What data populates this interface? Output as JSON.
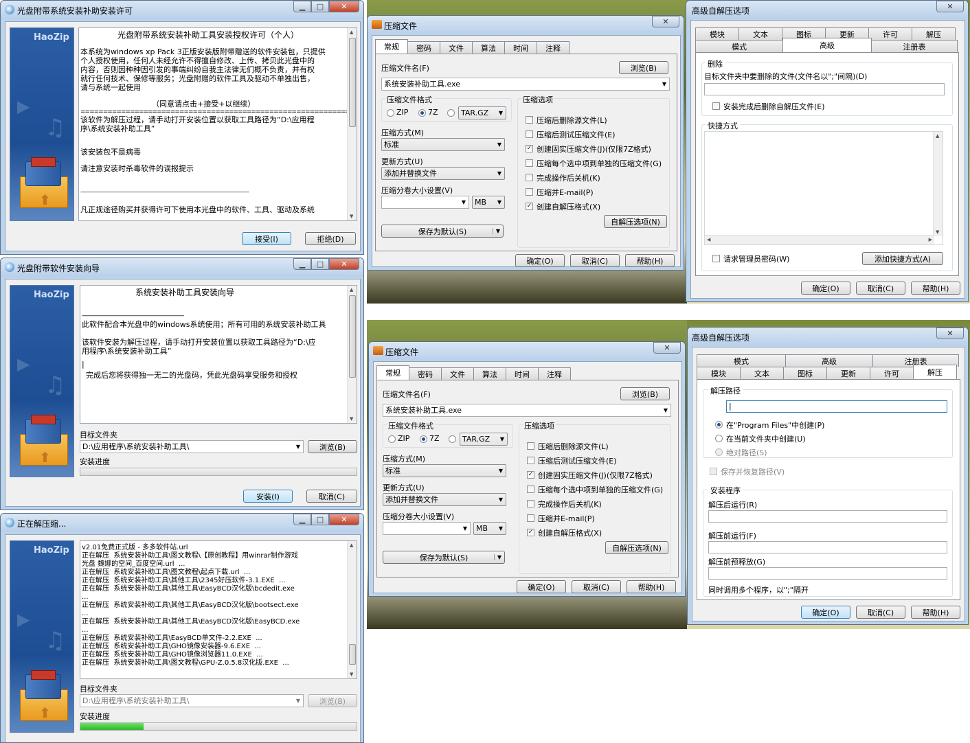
{
  "license_window": {
    "title": "光盘附带系统安装补助安装许可",
    "brand": "HaoZip",
    "heading": "光盘附带系统安装补助工具安装授权许可（个人）",
    "paragraph_lines": [
      "本系统为windows xp Pack 3正版安装版附带赠送的软件安装包，只提供",
      "个人授权使用，任何人未经允许不得擅自修改、上传、拷贝此光盘中的",
      "内容，否则因种种因引发的事端纠纷自我主法律无们概不负责，并有权",
      "就行任何技术、保修等服务；光盘附赠的软件工具及驱动不单独出售，",
      "请与系统一起使用"
    ],
    "agree_hint": "（同意请点击+接受+以继续）",
    "separator": "==============================================================",
    "path_note_lines": [
      "该软件为解压过程，请手动打开安装位置以获取工具路径为“D:\\应用程",
      "序\\系统安装补助工具”"
    ],
    "virus_note": "该安装包不是病毒",
    "antivirus_note": "请注意安装时杀毒软件的误报提示",
    "dash_line": "———————————————————————————————————",
    "purchase_note": "凡正规途径购买并获得许可下使用本光盘中的软件、工具、驱动及系统",
    "accept_button": "接受(I)",
    "reject_button": "拒绝(D)"
  },
  "wizard_window": {
    "title": "光盘附带软件安装向导",
    "brand": "HaoZip",
    "heading": "系统安装补助工具安装向导",
    "separator": "------------------------------------------------------------------",
    "line1": "此软件配合本光盘中的windows系统使用；所有可用的系统安装补助工具",
    "path_lines": [
      "该软件安装为解压过程，请手动打开安装位置以获取工具路径为“D:\\应",
      "用程序\\系统安装补助工具”"
    ],
    "cursor": "|",
    "complete_line": "完成后您将获得独一无二的光盘码，凭此光盘码享受服务和授权",
    "target_label": "目标文件夹",
    "target_value": "D:\\应用程序\\系统安装补助工具\\",
    "browse_button": "浏览(B)",
    "progress_label": "安装进度",
    "progress_value": 0,
    "install_button": "安装(I)",
    "cancel_button": "取消(C)"
  },
  "extract_window": {
    "title": "正在解压缩...",
    "brand": "HaoZip",
    "log_lines": [
      "v2.01免费正式版 - 多多软件站.url",
      "正在解压  系统安装补助工具\\图文教程\\【原创教程】用winrar制作游戏",
      "光盘 魏娜的空间_百度空间.url  ...",
      "正在解压  系统安装补助工具\\图文教程\\起点下载.url  ...",
      "正在解压  系统安装补助工具\\其他工具\\2345好压软件-3.1.EXE  ...",
      "正在解压  系统安装补助工具\\其他工具\\EasyBCD汉化版\\bcdedit.exe",
      "...",
      "正在解压  系统安装补助工具\\其他工具\\EasyBCD汉化版\\bootsect.exe",
      "...",
      "正在解压  系统安装补助工具\\其他工具\\EasyBCD汉化版\\EasyBCD.exe",
      "...",
      "正在解压  系统安装补助工具\\EasyBCD单文件-2.2.EXE  ...",
      "正在解压  系统安装补助工具\\GHO镜像安装器-9.6.EXE  ...",
      "正在解压  系统安装补助工具\\GHO镜像浏览器11.0.EXE  ...",
      "正在解压  系统安装补助工具\\图文教程\\GPU-Z.0.5.8汉化版.EXE  ..."
    ],
    "target_label": "目标文件夹",
    "target_value": "D:\\应用程序\\系统安装补助工具\\",
    "browse_button": "浏览(B)",
    "progress_label": "安装进度",
    "progress_value": 0.23
  },
  "compress_top": {
    "title": "压缩文件",
    "tabs": [
      "常规",
      "密码",
      "文件",
      "算法",
      "时间",
      "注释"
    ],
    "filename_label": "压缩文件名(F)",
    "browse_button": "浏览(B)",
    "filename_value": "系统安装补助工具.exe",
    "format_label": "压缩文件格式",
    "fmt_zip": "ZIP",
    "fmt_7z": "7Z",
    "fmt_other": "TAR.GZ",
    "method_label": "压缩方式(M)",
    "method_value": "标准",
    "update_label": "更新方式(U)",
    "update_value": "添加并替换文件",
    "split_label": "压缩分卷大小设置(V)",
    "split_unit": "MB",
    "save_default": "保存为默认(S)",
    "options_label": "压缩选项",
    "options": [
      {
        "text": "压缩后删除源文件(L)",
        "checked": false
      },
      {
        "text": "压缩后测试压缩文件(E)",
        "checked": false
      },
      {
        "text": "创建固实压缩文件(J)(仅限7Z格式)",
        "checked": true
      },
      {
        "text": "压缩每个选中项到单独的压缩文件(G)",
        "checked": false
      },
      {
        "text": "完成操作后关机(K)",
        "checked": false
      },
      {
        "text": "压缩并E-mail(P)",
        "checked": false
      },
      {
        "text": "创建自解压格式(X)",
        "checked": true
      }
    ],
    "sfx_button": "自解压选项(N)",
    "ok": "确定(O)",
    "cancel": "取消(C)",
    "help": "帮助(H)"
  },
  "compress_bottom": {
    "title": "压缩文件",
    "tabs": [
      "常规",
      "密码",
      "文件",
      "算法",
      "时间",
      "注释"
    ],
    "filename_label": "压缩文件名(F)",
    "browse_button": "浏览(B)",
    "filename_value": "系统安装补助工具.exe",
    "format_label": "压缩文件格式",
    "fmt_zip": "ZIP",
    "fmt_7z": "7Z",
    "fmt_other": "TAR.GZ",
    "method_label": "压缩方式(M)",
    "method_value": "标准",
    "update_label": "更新方式(U)",
    "update_value": "添加并替换文件",
    "split_label": "压缩分卷大小设置(V)",
    "split_unit": "MB",
    "save_default": "保存为默认(S)",
    "options_label": "压缩选项",
    "options": [
      {
        "text": "压缩后删除源文件(L)",
        "checked": false
      },
      {
        "text": "压缩后测试压缩文件(E)",
        "checked": false
      },
      {
        "text": "创建固实压缩文件(J)(仅限7Z格式)",
        "checked": true
      },
      {
        "text": "压缩每个选中项到单独的压缩文件(G)",
        "checked": false
      },
      {
        "text": "完成操作后关机(K)",
        "checked": false
      },
      {
        "text": "压缩并E-mail(P)",
        "checked": false
      },
      {
        "text": "创建自解压格式(X)",
        "checked": true
      }
    ],
    "sfx_button": "自解压选项(N)",
    "ok": "确定(O)",
    "cancel": "取消(C)",
    "help": "帮助(H)"
  },
  "sfx_top": {
    "title": "高级自解压选项",
    "tabs_row1": [
      "模块",
      "文本",
      "图标",
      "更新",
      "许可",
      "解压"
    ],
    "tabs_row2": [
      "模式",
      "高级",
      "注册表"
    ],
    "delete_group": "删除",
    "delete_label": "目标文件夹中要删除的文件(文件名以\";\"间隔)(D)",
    "delete_after": "安装完成后删除自解压文件(E)",
    "shortcut_group": "快捷方式",
    "request_admin": "请求管理员密码(W)",
    "add_shortcut": "添加快捷方式(A)",
    "ok": "确定(O)",
    "cancel": "取消(C)",
    "help": "帮助(H)"
  },
  "sfx_bottom": {
    "title": "高级自解压选项",
    "tabs_row1": [
      "模式",
      "高级",
      "注册表"
    ],
    "tabs_row2": [
      "模块",
      "文本",
      "图标",
      "更新",
      "许可",
      "解压"
    ],
    "path_group": "解压路径",
    "radio1": "在\"Program Files\"中创建(P)",
    "radio2": "在当前文件夹中创建(U)",
    "radio3": "绝对路径(S)",
    "keep_path": "保存并恢复路径(V)",
    "install_group": "安装程序",
    "run_after": "解压后运行(R)",
    "run_before": "解压前运行(F)",
    "pre_release": "解压前预释放(G)",
    "multi_note": "同时调用多个程序，以\";\"隔开",
    "ok": "确定(O)",
    "cancel": "取消(C)",
    "help": "帮助(H)"
  }
}
